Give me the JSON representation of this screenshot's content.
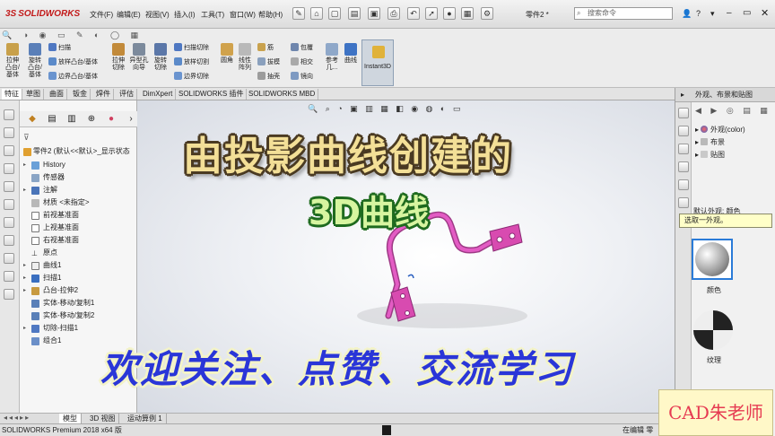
{
  "titlebar": {
    "brand": "SOLIDWORKS",
    "menus": [
      "文件(F)",
      "编辑(E)",
      "视图(V)",
      "插入(I)",
      "工具(T)",
      "窗口(W)",
      "帮助(H)"
    ],
    "doc_title": "零件2 *",
    "search_placeholder": "搜索命令"
  },
  "commands": {
    "extrude_boss": "拉伸\n凸台/\n基体",
    "revolve_boss": "旋转\n凸台/\n基体",
    "sweep": "扫描",
    "loft": "放样凸台/基体",
    "boundary": "边界凸台/基体",
    "extrude_cut": "拉伸\n切除",
    "hole_wizard": "异型孔\n向导",
    "revolve_cut": "旋转\n切除",
    "swept_cut": "扫描切除",
    "lofted_cut": "放样切割",
    "boundary_cut": "边界切除",
    "fillet": "圆角",
    "linear_pattern": "线性\n阵列",
    "rib": "筋",
    "draft": "拔模",
    "shell": "抽壳",
    "wrap": "包覆",
    "intersect": "相交",
    "mirror": "镜向",
    "reference": "参考\n几...",
    "curves": "曲线",
    "instant3d": "Instant3D"
  },
  "tabs": [
    "特征",
    "草图",
    "曲面",
    "钣金",
    "焊件",
    "评估",
    "DimXpert",
    "SOLIDWORKS 插件",
    "SOLIDWORKS MBD"
  ],
  "tree": {
    "root": "零件2 (默认<<默认>_显示状态",
    "items": [
      "History",
      "传感器",
      "注解",
      "材质 <未指定>",
      "前视基准面",
      "上视基准面",
      "右视基准面",
      "原点",
      "曲线1",
      "扫描1",
      "凸台-拉伸2",
      "实体-移动/复制1",
      "实体-移动/复制2",
      "切除-扫描1",
      "组合1"
    ]
  },
  "right_panel": {
    "title": "外观、布景和贴图",
    "nodes": [
      "外观(color)",
      "布景",
      "贴图"
    ],
    "default_label": "默认外观: 颜色",
    "tooltip": "选取一外观。",
    "swatch1_label": "颜色",
    "swatch2_label": "纹理"
  },
  "bottom_tabs": [
    "模型",
    "3D 视图",
    "运动算例 1"
  ],
  "status": {
    "version": "SOLIDWORKS Premium 2018 x64 版",
    "editing": "在编辑 零"
  },
  "captions": {
    "title": "由投影曲线创建的",
    "subtitle": "3D曲线",
    "footer": "欢迎关注、点赞、交流学习"
  },
  "watermark": "CAD朱老师",
  "colors": {
    "brand_red": "#c21a1a",
    "part_pink": "#d84bb0",
    "caption_gold": "#f3df97",
    "caption_green": "#d7f5a0",
    "caption_blue": "#2a36d8"
  }
}
